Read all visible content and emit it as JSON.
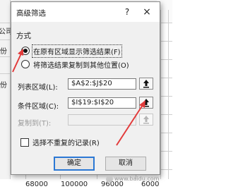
{
  "sheet": {
    "left_header_text": "公司",
    "row_label_1": "份",
    "row_label_2": "份",
    "bottom_values": [
      "68000",
      "100000",
      "96000",
      "6000"
    ]
  },
  "dialog": {
    "title": "高级筛选",
    "help_label": "?",
    "close_label": "×",
    "section_label": "方式",
    "radio_inplace_label": "在原有区域显示筛选结果(F)",
    "radio_copy_label": "将筛选结果复制到其他位置(O)",
    "selected_mode": "inplace",
    "list_range_label": "列表区域(L):",
    "list_range_value": "$A$2:$J$20",
    "criteria_range_label": "条件区域(C):",
    "criteria_range_value": "$I$19:$I$20",
    "copy_to_label": "复制到(T):",
    "copy_to_value": "",
    "unique_records_label": "选择不重复的记录(R)",
    "unique_records_checked": false,
    "ok_label": "确定",
    "cancel_label": "取消"
  },
  "annotation": {
    "arrow_color": "#e23b3b"
  },
  "watermark": "www.baidu.com"
}
